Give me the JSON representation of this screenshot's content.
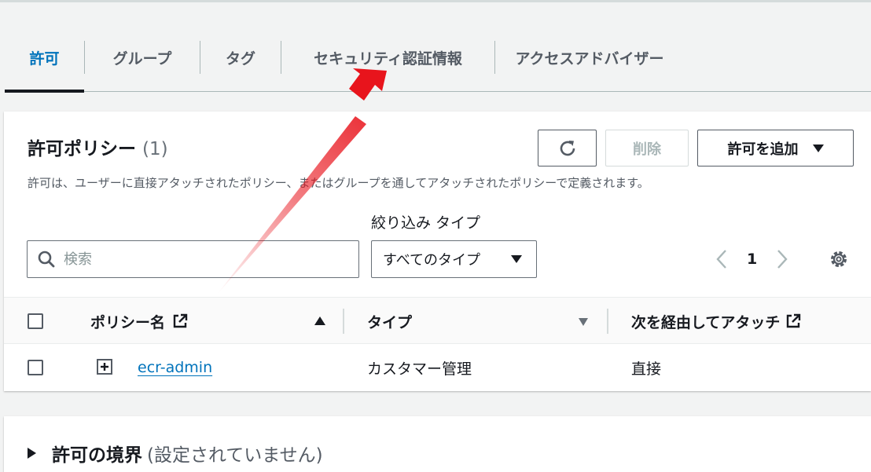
{
  "tabs": [
    {
      "label": "許可"
    },
    {
      "label": "グループ"
    },
    {
      "label": "タグ"
    },
    {
      "label": "セキュリティ認証情報"
    },
    {
      "label": "アクセスアドバイザー"
    }
  ],
  "policies": {
    "title": "許可ポリシー",
    "count": "(1)",
    "description": "許可は、ユーザーに直接アタッチされたポリシー、またはグループを通してアタッチされたポリシーで定義されます。",
    "delete_label": "削除",
    "add_label": "許可を追加",
    "filter_type_label": "絞り込み タイプ",
    "search_placeholder": "検索",
    "type_select_value": "すべてのタイプ",
    "page": "1",
    "columns": {
      "policy_name": "ポリシー名",
      "type": "タイプ",
      "attached_via": "次を経由してアタッチ"
    },
    "rows": [
      {
        "name": "ecr-admin",
        "type": "カスタマー管理",
        "attached_via": "直接"
      }
    ]
  },
  "boundary": {
    "title": "許可の境界",
    "status": "(設定されていません)"
  },
  "colors": {
    "accent": "#0073bb",
    "annotation_arrow": "#e8141c"
  }
}
